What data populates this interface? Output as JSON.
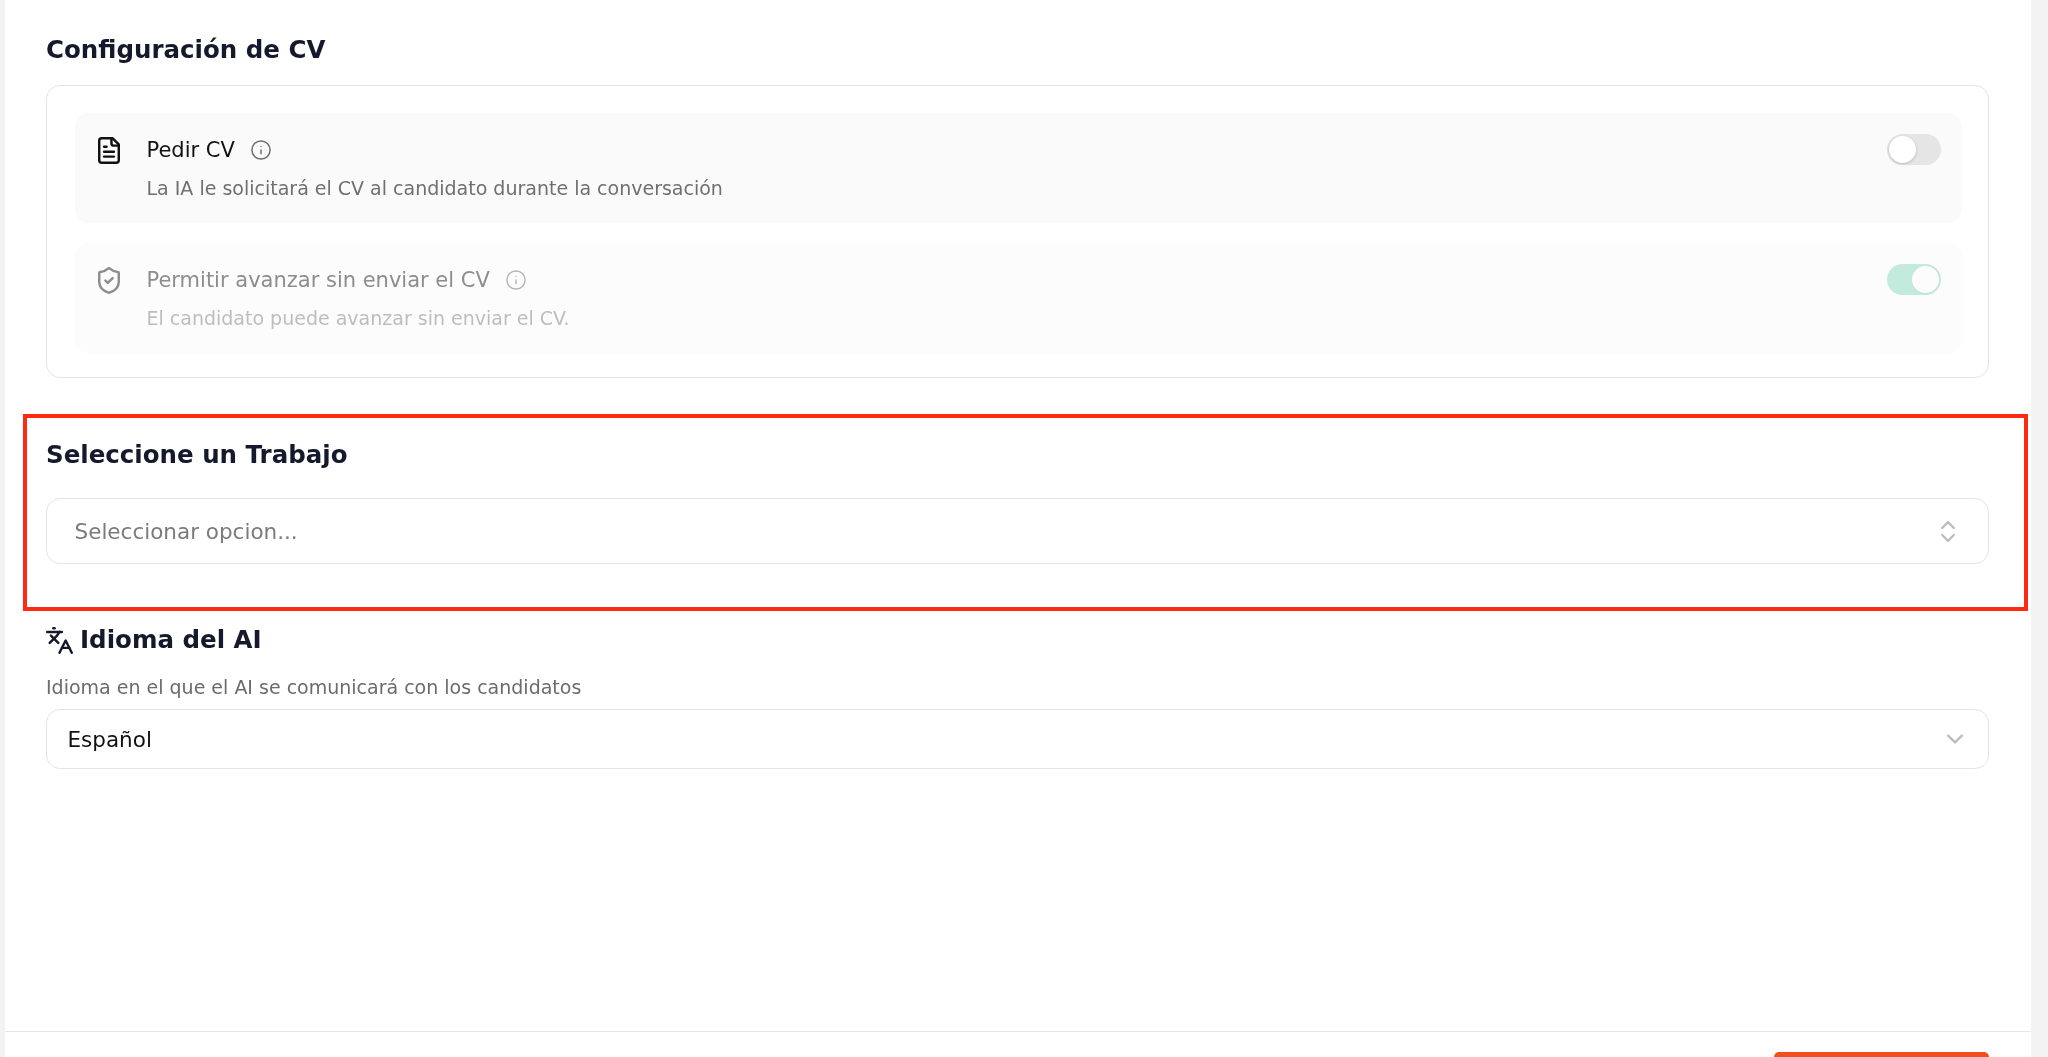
{
  "cv_config": {
    "title": "Configuración de CV",
    "options": [
      {
        "title": "Pedir CV",
        "description": "La IA le solicitará el CV al candidato durante la conversación",
        "on": false,
        "disabled": false
      },
      {
        "title": "Permitir avanzar sin enviar el CV",
        "description": "El candidato puede avanzar sin enviar el CV.",
        "on": true,
        "disabled": true
      }
    ]
  },
  "job_section": {
    "title": "Seleccione un Trabajo",
    "highlighted": true,
    "select": {
      "placeholder": "Seleccionar opcion..."
    }
  },
  "ai_language": {
    "title": "Idioma del AI",
    "description": "Idioma en el que el AI se comunicará con los candidatos",
    "select": {
      "value": "Español"
    }
  }
}
